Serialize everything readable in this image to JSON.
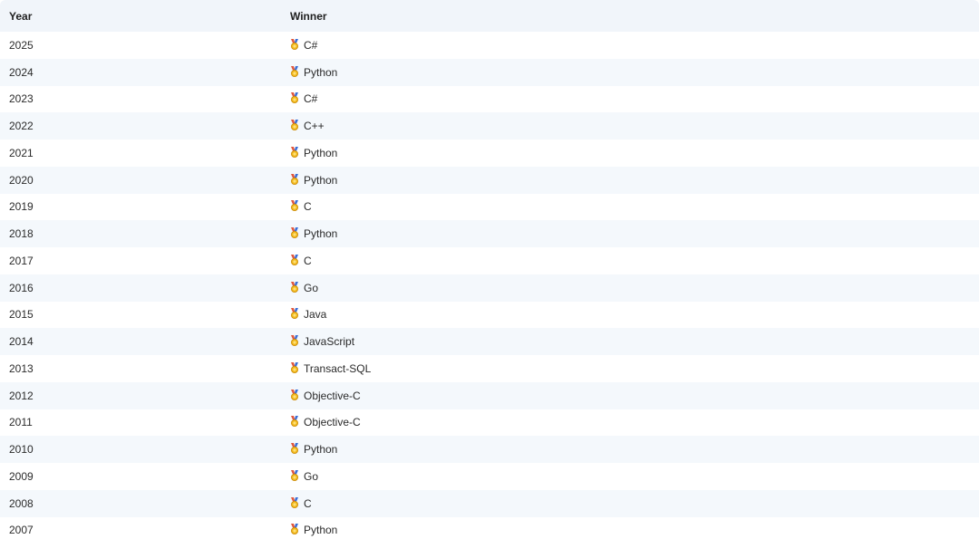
{
  "table": {
    "headers": {
      "year": "Year",
      "winner": "Winner"
    },
    "icon_name": "medal-icon",
    "colors": {
      "header_bg": "#f1f5fa",
      "stripe_bg": "#f4f8fc",
      "medal_ribbon": "#e0563b",
      "medal_gold": "#f2b91b"
    },
    "rows": [
      {
        "year": "2025",
        "winner": "C#"
      },
      {
        "year": "2024",
        "winner": "Python"
      },
      {
        "year": "2023",
        "winner": "C#"
      },
      {
        "year": "2022",
        "winner": "C++"
      },
      {
        "year": "2021",
        "winner": "Python"
      },
      {
        "year": "2020",
        "winner": "Python"
      },
      {
        "year": "2019",
        "winner": "C"
      },
      {
        "year": "2018",
        "winner": "Python"
      },
      {
        "year": "2017",
        "winner": "C"
      },
      {
        "year": "2016",
        "winner": "Go"
      },
      {
        "year": "2015",
        "winner": "Java"
      },
      {
        "year": "2014",
        "winner": "JavaScript"
      },
      {
        "year": "2013",
        "winner": "Transact-SQL"
      },
      {
        "year": "2012",
        "winner": "Objective-C"
      },
      {
        "year": "2011",
        "winner": "Objective-C"
      },
      {
        "year": "2010",
        "winner": "Python"
      },
      {
        "year": "2009",
        "winner": "Go"
      },
      {
        "year": "2008",
        "winner": "C"
      },
      {
        "year": "2007",
        "winner": "Python"
      }
    ]
  }
}
